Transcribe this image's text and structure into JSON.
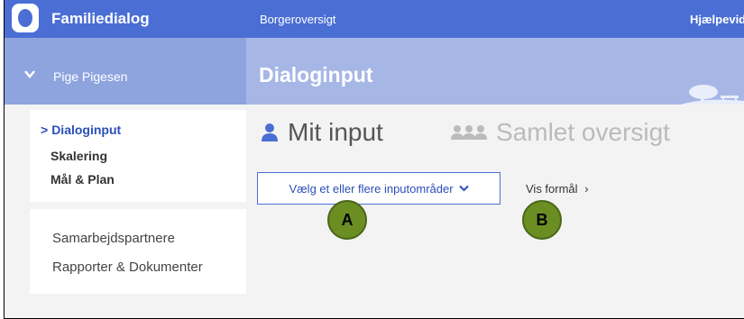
{
  "header": {
    "app_title": "Familiedialog",
    "nav_citizens": "Borgeroversigt",
    "nav_help": "Hjælpevide"
  },
  "band": {
    "person_name": "Pige Pigesen",
    "page_title": "Dialoginput"
  },
  "sidebar": {
    "menu": [
      {
        "label": "Dialoginput",
        "active": true,
        "caret": ">"
      },
      {
        "label": "Skalering"
      },
      {
        "label": "Mål & Plan"
      }
    ],
    "links": [
      {
        "label": "Samarbejdspartnere"
      },
      {
        "label": "Rapporter & Dokumenter"
      }
    ]
  },
  "main": {
    "tabs": [
      {
        "label": "Mit input",
        "icon": "person-icon"
      },
      {
        "label": "Samlet oversigt",
        "icon": "group-icon"
      }
    ],
    "select_label": "Vælg et eller flere inputområder",
    "purpose_label": "Vis formål",
    "purpose_chevron": "›"
  },
  "markers": {
    "a": "A",
    "b": "B"
  },
  "colors": {
    "topbar": "#4a6ed4",
    "band": "#a6b7e6",
    "marker": "#6b8e23"
  }
}
